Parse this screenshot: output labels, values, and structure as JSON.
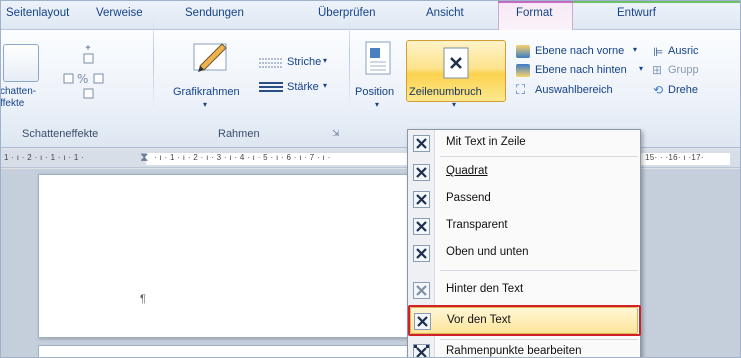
{
  "tabs": [
    "Seitenlayout",
    "Verweise",
    "Sendungen",
    "Überprüfen",
    "Ansicht",
    "Format",
    "Entwurf"
  ],
  "ribbon": {
    "shadow_label_line1": "chatten-",
    "shadow_label_line2": "ffekte",
    "shadow_group": "Schatteneffekte",
    "frame_label": "Grafikrahmen",
    "frame_group": "Rahmen",
    "striche": "Striche",
    "staerke": "Stärke",
    "position": "Position",
    "zeilenumbruch": "Zeilenumbruch",
    "ebene_vorne": "Ebene nach vorne",
    "ebene_hinten": "Ebene nach hinten",
    "auswahlbereich": "Auswahlbereich",
    "ausrichten": "Ausric",
    "gruppieren": "Grupp",
    "drehen": "Drehe"
  },
  "ruler": {
    "left": "1 · ı · 2 · ı · 1 · ı · 1 ·",
    "middle": "· ı · 1 · ı · 2 · ı · 3 · ı · 4 · ı · 5 · ı · 6 · ı · 7 · ı ·",
    "right": "15· · ·16· ı ·17·"
  },
  "document": {
    "pilcrow": "¶"
  },
  "menu": {
    "items": [
      "Mit Text in Zeile",
      "Quadrat",
      "Passend",
      "Transparent",
      "Oben und unten",
      "Hinter den Text",
      "Vor den Text",
      "Rahmenpunkte bearbeiten"
    ]
  },
  "colors": {
    "highlight_border": "#d0202a",
    "format_tab": "#c46cc2",
    "entwurf_tab": "#6cc06c"
  }
}
